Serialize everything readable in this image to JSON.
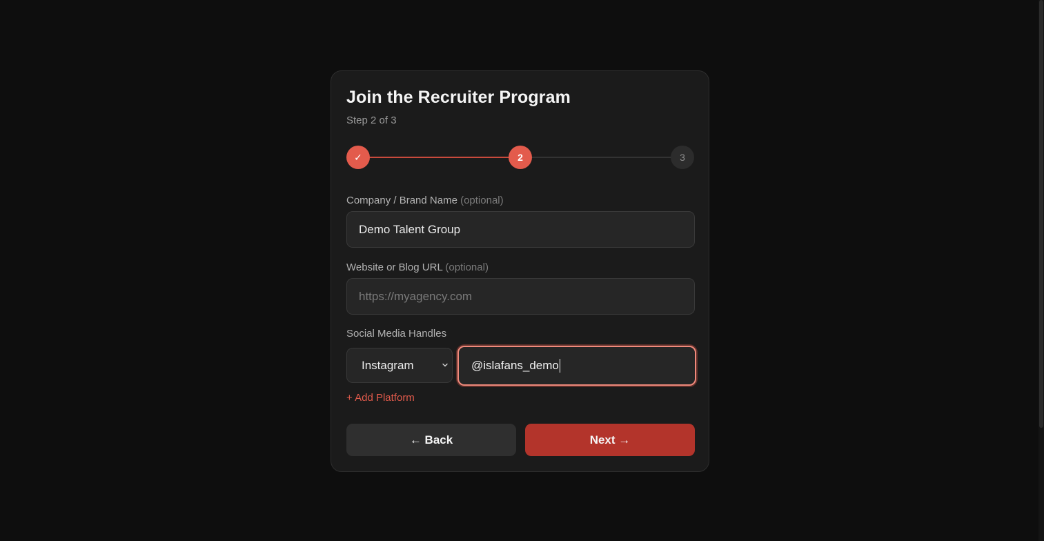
{
  "form": {
    "title": "Join the Recruiter Program",
    "step_text": "Step 2 of 3"
  },
  "stepper": {
    "steps": [
      {
        "label": "✓",
        "state": "complete"
      },
      {
        "label": "2",
        "state": "current"
      },
      {
        "label": "3",
        "state": "upcoming"
      }
    ],
    "current": 2,
    "total": 3
  },
  "fields": {
    "company": {
      "label": "Company / Brand Name",
      "optional": "(optional)",
      "value": "Demo Talent Group"
    },
    "website": {
      "label": "Website or Blog URL",
      "optional": "(optional)",
      "value": "",
      "placeholder": "https://myagency.com"
    },
    "social": {
      "label": "Social Media Handles",
      "platform": "Instagram",
      "handle": "@islafans_demo",
      "add_label": "+ Add Platform"
    }
  },
  "buttons": {
    "back": "← Back",
    "next": "Next →"
  },
  "colors": {
    "accent": "#e35b4c",
    "primary_button": "#b3342b",
    "background": "#0e0e0e",
    "card": "#1b1b1b"
  }
}
